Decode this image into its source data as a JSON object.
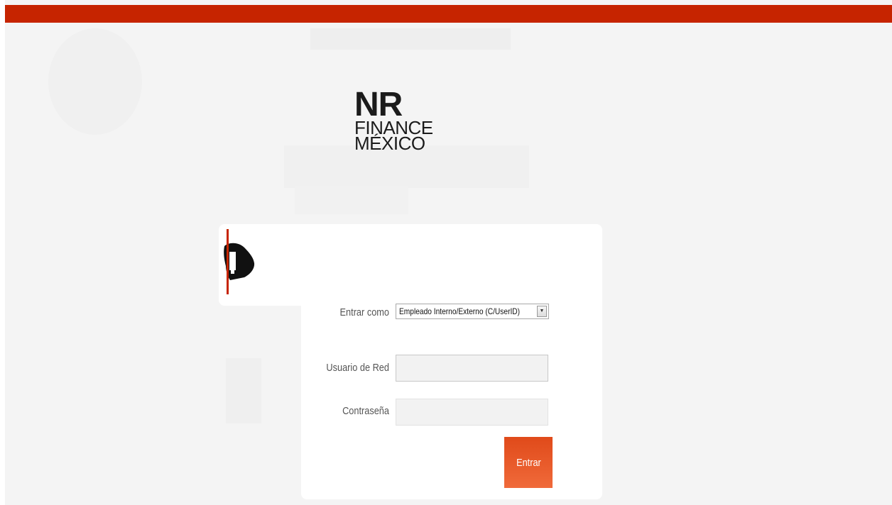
{
  "brand": {
    "logo_line1": "NR",
    "logo_line2": "FINANCE",
    "logo_line3": "MÉXICO",
    "accent_color": "#c62400",
    "button_color": "#e8541f"
  },
  "login": {
    "role_label": "Entrar como",
    "role_selected": "Empleado Interno/Externo (C/UserID)",
    "username_label": "Usuario de Red",
    "username_value": "",
    "password_label": "Contraseña",
    "password_value": "",
    "submit_label": "Entrar"
  },
  "icons": {
    "avatar": "user-avatar-icon",
    "select_arrow": "chevron-down-icon"
  }
}
